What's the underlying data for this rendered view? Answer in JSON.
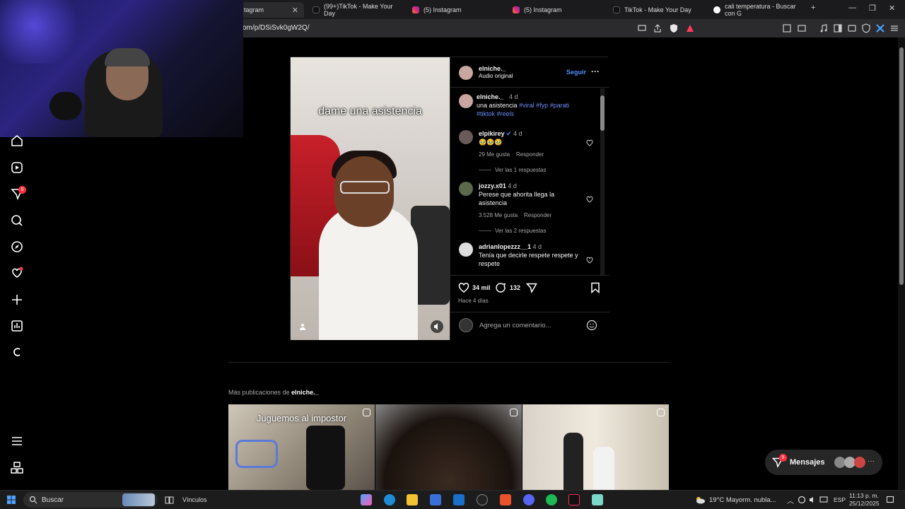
{
  "browser": {
    "tabs": [
      {
        "label": "tagram",
        "active": true
      },
      {
        "label": "(99+)TikTok - Make Your Day"
      },
      {
        "label": "(5) Instagram"
      },
      {
        "label": "(5) Instagram"
      },
      {
        "label": "TikTok - Make Your Day"
      },
      {
        "label": "cali temperatura - Buscar con G"
      }
    ],
    "url": "om/p/DSiSvk0gW2Q/"
  },
  "sidebar": {
    "notification_badge": "5"
  },
  "post": {
    "reel_caption": "dame una asistencia",
    "author": "elniche._",
    "audio": "Audio original",
    "follow_label": "Seguir",
    "caption": {
      "user": "elniche._",
      "age": "4 d",
      "text": "una asistencia",
      "tags_line1": "#viral #fyp #parati",
      "tags_line2": "#tiktok #reels"
    },
    "comments": [
      {
        "user": "elpikirey",
        "verified": true,
        "age": "4 d",
        "text": "🥹🥹🥹",
        "likes": "29 Me gusta",
        "reply": "Responder",
        "replies": "Ver las 1 respuestas"
      },
      {
        "user": "jozzy.x01",
        "age": "4 d",
        "text_line1": "Perese que ahorita llega la",
        "text_line2": "asistencia",
        "likes": "3.528 Me gusta",
        "reply": "Responder",
        "replies": "Ver las 2 respuestas"
      },
      {
        "user": "adrianlopezzz__1",
        "age": "4 d",
        "text_line1": "Tenía que decirle respete respete y",
        "text_line2": "respete"
      }
    ],
    "like_count": "34 mil",
    "comment_count": "132",
    "posted": "Hace 4 días",
    "comment_placeholder": "Agrega un comentario..."
  },
  "more": {
    "prefix": "Más publicaciones de",
    "user": "elniche._",
    "thumb1_caption": "Juguemos al impostor"
  },
  "messages": {
    "label": "Mensajes",
    "badge": "5"
  },
  "taskbar": {
    "search": "Buscar",
    "links": "Vínculos",
    "weather": "19°C  Mayorm. nubla...",
    "lang": "ESP",
    "time": "11:13 p. m.",
    "date": "25/12/2025"
  },
  "colors": {
    "accent": "#4e90f5",
    "link": "#6c8ef5",
    "badge": "#ff3040"
  }
}
